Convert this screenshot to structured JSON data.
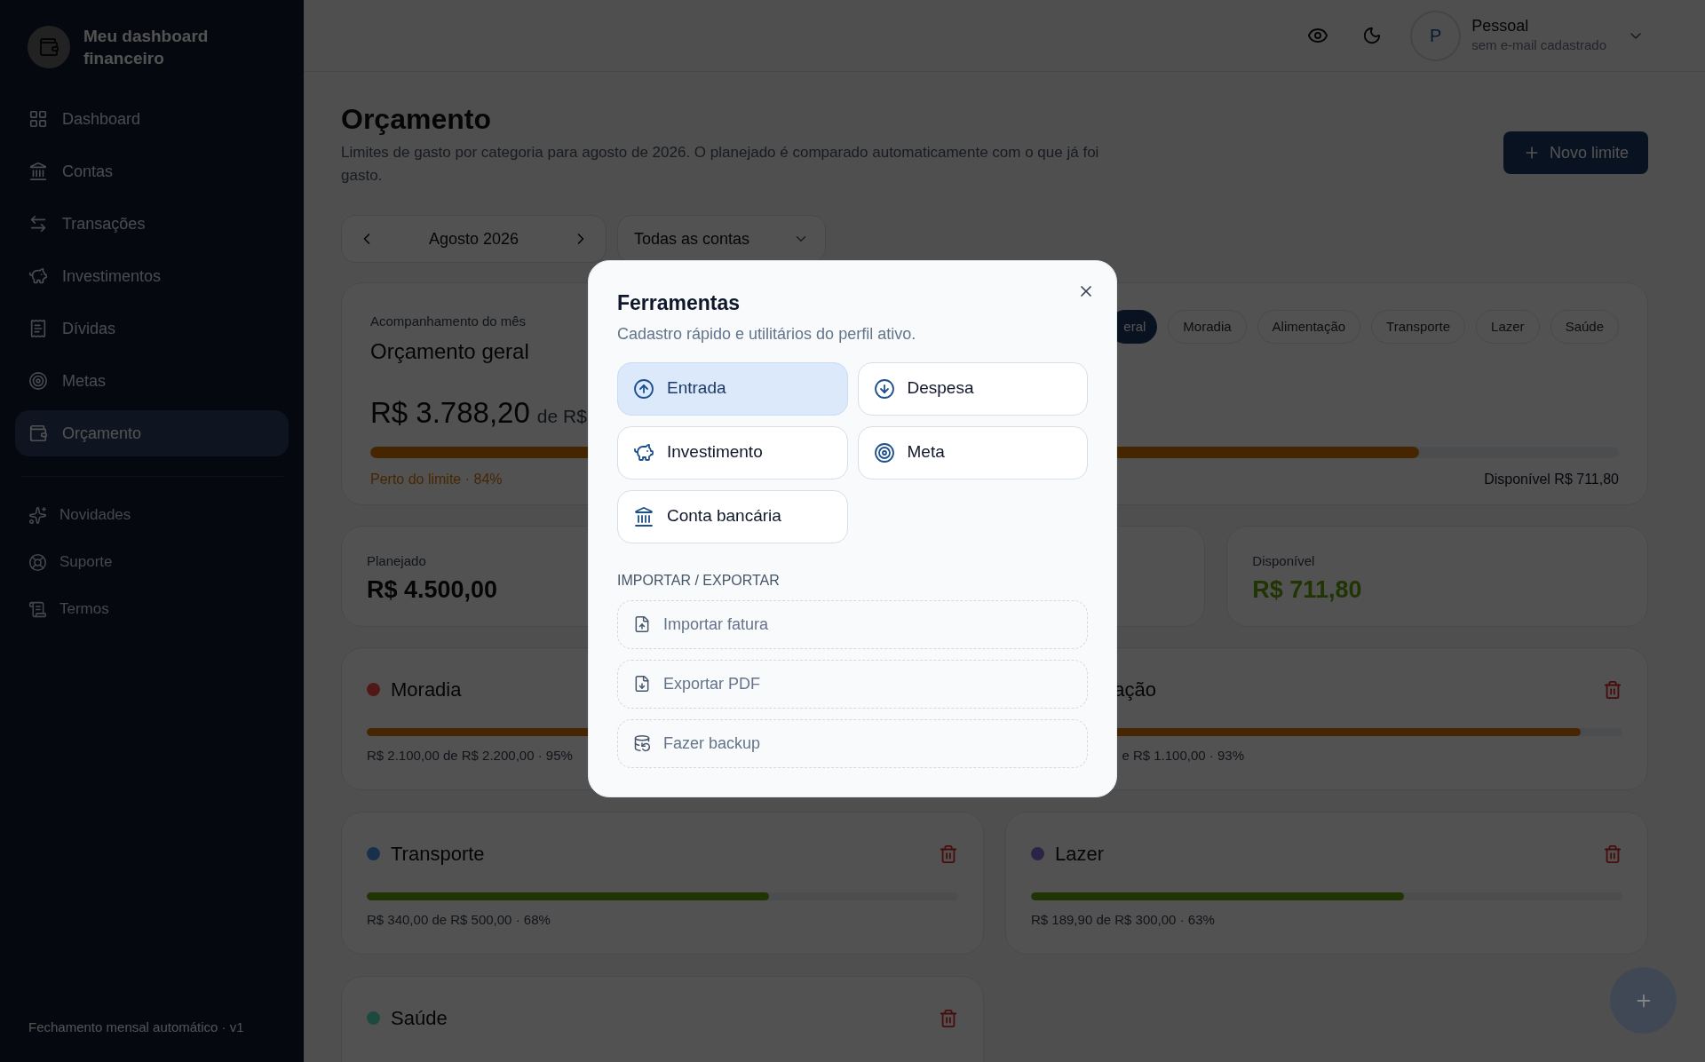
{
  "sidebar": {
    "brand": "Meu dashboard financeiro",
    "items": [
      {
        "label": "Dashboard",
        "kind": "dashboard",
        "selected": false
      },
      {
        "label": "Contas",
        "kind": "accounts",
        "selected": false
      },
      {
        "label": "Transações",
        "kind": "transactions",
        "selected": false
      },
      {
        "label": "Investimentos",
        "kind": "investments",
        "selected": false
      },
      {
        "label": "Dívidas",
        "kind": "debts",
        "selected": false
      },
      {
        "label": "Metas",
        "kind": "goals",
        "selected": false
      },
      {
        "label": "Orçamento",
        "kind": "budget",
        "selected": true
      }
    ],
    "secondary_items": [
      {
        "label": "Novidades",
        "kind": "news"
      },
      {
        "label": "Suporte",
        "kind": "support"
      },
      {
        "label": "Termos",
        "kind": "terms"
      }
    ],
    "footer": "Fechamento mensal automático · v1"
  },
  "header": {
    "profile": {
      "initial": "P",
      "name": "Pessoal",
      "email": "sem e-mail cadastrado"
    }
  },
  "page": {
    "title": "Orçamento",
    "description": "Limites de gasto por categoria para agosto de 2026. O planejado é comparado automaticamente com o que já foi gasto.",
    "new_button": "Novo limite",
    "month": "Agosto 2026",
    "account_filter": "Todas as contas"
  },
  "summary": {
    "eyebrow": "Acompanhamento do mês",
    "title": "Orçamento geral",
    "spent": "R$ 3.788,20",
    "of": "de R$",
    "level": 0.84,
    "status": "Perto do limite · 84%",
    "available": "Disponível R$ 711,80",
    "chips": [
      {
        "label": "eral",
        "selected": true
      },
      {
        "label": "Moradia",
        "selected": false
      },
      {
        "label": "Alimentação",
        "selected": false
      },
      {
        "label": "Transporte",
        "selected": false
      },
      {
        "label": "Lazer",
        "selected": false
      },
      {
        "label": "Saúde",
        "selected": false
      }
    ]
  },
  "stats": [
    {
      "label": "Planejado",
      "value": "R$ 4.500,00"
    },
    {
      "label": "Disponível",
      "value": "R$ 711,80"
    }
  ],
  "categories": [
    {
      "name": "Moradia",
      "color": "#501818",
      "level": 0.95,
      "detail": "R$ 2.100,00 de R$ 2.200,00 · 95%"
    },
    {
      "name": "ação",
      "level": 0.93,
      "detail": "e R$ 1.100,00 · 93%"
    },
    {
      "name": "Transporte",
      "color": "#19304c",
      "level": 0.68,
      "detail": "R$ 340,00 de R$ 500,00 · 68%"
    },
    {
      "name": "Lazer",
      "color": "#2c2346",
      "level": 0.63,
      "detail": "R$ 189,90 de R$ 300,00 · 63%"
    },
    {
      "name": "Saúde",
      "color": "#1c4a3e"
    }
  ],
  "modal": {
    "title": "Ferramentas",
    "subtitle": "Cadastro rápido e utilitários do perfil ativo.",
    "actions": [
      {
        "label": "Entrada",
        "kind": "income",
        "selected": true
      },
      {
        "label": "Despesa",
        "kind": "expense",
        "selected": false
      },
      {
        "label": "Investimento",
        "kind": "investment",
        "selected": false
      },
      {
        "label": "Meta",
        "kind": "goal",
        "selected": false
      },
      {
        "label": "Conta bancária",
        "kind": "bank",
        "selected": false
      }
    ],
    "section_label": "IMPORTAR / EXPORTAR",
    "tools": [
      {
        "label": "Importar fatura",
        "kind": "import"
      },
      {
        "label": "Exportar PDF",
        "kind": "export"
      },
      {
        "label": "Fazer backup",
        "kind": "backup"
      }
    ]
  }
}
